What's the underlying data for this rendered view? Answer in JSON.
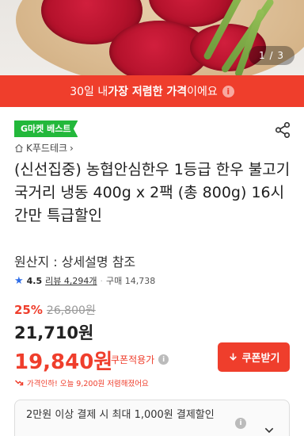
{
  "gallery": {
    "pager": "1 / 3",
    "image_icon": "product-photo"
  },
  "banner": {
    "prefix": "30일 내 ",
    "highlight": "가장 저렴한 가격",
    "suffix": "이에요",
    "icon": "info-icon"
  },
  "badge": "G마켓 베스트",
  "share_icon": "share-icon",
  "seller": {
    "icon": "home-icon",
    "name": "K푸드테크",
    "arrow": "›"
  },
  "product": {
    "title": "(신선집중) 농협안심한우 1등급 한우 불고기 국거리  냉동 400g x 2팩 (총 800g) 16시간만 특급할인",
    "origin": "원산지 : 상세설명 참조"
  },
  "rating": {
    "score": "4.5",
    "review_label": "리뷰 4,294개",
    "sep": "·",
    "purchase_label": "구매 14,738"
  },
  "price": {
    "discount_rate": "25%",
    "original": "26,800원",
    "sale": "21,710원",
    "coupon_price": "19,840원",
    "coupon_label": "쿠폰적용가",
    "coupon_button": "쿠폰받기",
    "cheaper_note": "가격인하! 오늘 9,200원 저렴해졌어요"
  },
  "benefit": {
    "text": "2만원 이상 결제 시 최대 1,000원 결제할인"
  },
  "colors": {
    "accent": "#ef3e2c",
    "badge_green": "#23b83b",
    "star_blue": "#2f6ee8"
  }
}
